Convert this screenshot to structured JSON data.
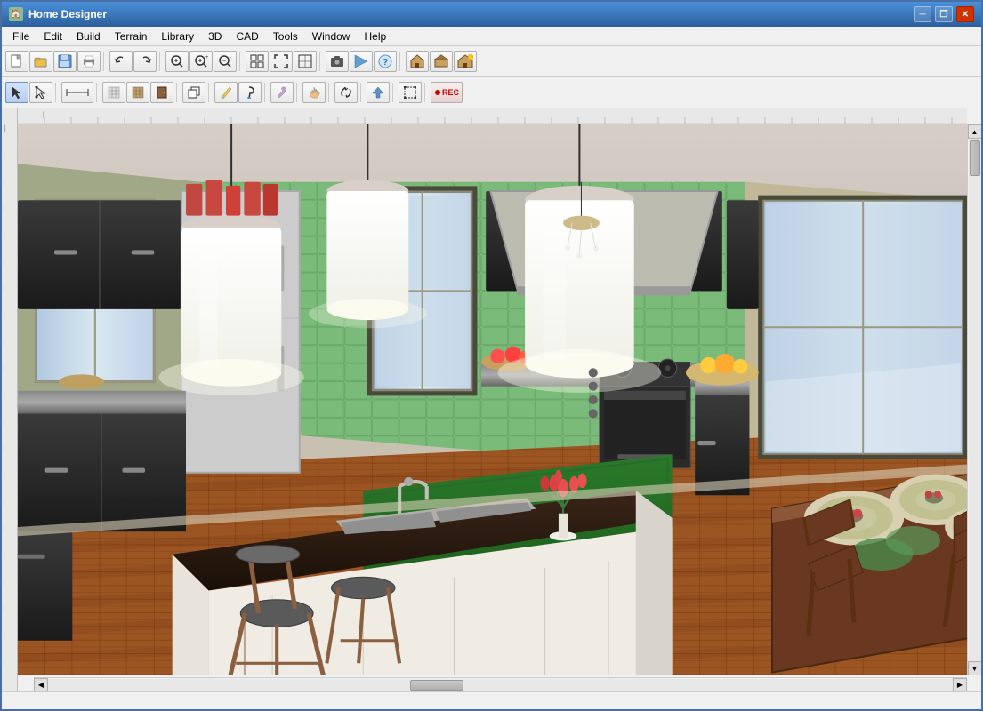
{
  "window": {
    "title": "Home Designer",
    "icon": "🏠"
  },
  "titlebar": {
    "minimize_label": "─",
    "maximize_label": "□",
    "close_label": "✕",
    "restore_label": "❐"
  },
  "menubar": {
    "items": [
      {
        "id": "file",
        "label": "File"
      },
      {
        "id": "edit",
        "label": "Edit"
      },
      {
        "id": "build",
        "label": "Build"
      },
      {
        "id": "terrain",
        "label": "Terrain"
      },
      {
        "id": "library",
        "label": "Library"
      },
      {
        "id": "3d",
        "label": "3D"
      },
      {
        "id": "cad",
        "label": "CAD"
      },
      {
        "id": "tools",
        "label": "Tools"
      },
      {
        "id": "window",
        "label": "Window"
      },
      {
        "id": "help",
        "label": "Help"
      }
    ]
  },
  "toolbar1": {
    "buttons": [
      "📄",
      "📂",
      "💾",
      "🖨",
      "↩",
      "↪",
      "🔍",
      "🔍+",
      "🔍-",
      "⊞",
      "↔",
      "↕",
      "⊡",
      "⊞",
      "📷",
      "🔺",
      "❓",
      "🏠",
      "🏠",
      "🏠",
      "🔷"
    ]
  },
  "toolbar2": {
    "buttons": [
      "↖",
      "〜",
      "━",
      "▦",
      "🏠",
      "💾",
      "◻",
      "▦",
      "🔄",
      "✏",
      "🎨",
      "👆",
      "✕",
      "⟲",
      "REC"
    ]
  },
  "scene": {
    "description": "3D kitchen interior with dark cabinets, green tile backsplash, wood floors, island with sink, pendant lights"
  },
  "statusbar": {
    "text": ""
  }
}
